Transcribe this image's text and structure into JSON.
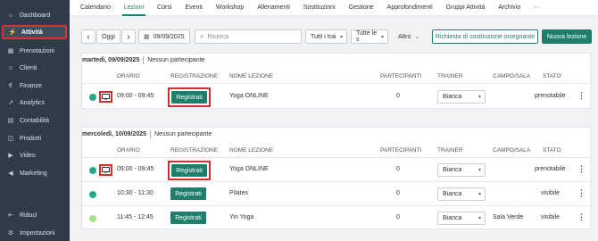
{
  "sidebar": {
    "items": [
      {
        "label": "Dashboard",
        "icon": "home-icon",
        "glyph": "⌂"
      },
      {
        "label": "Attività",
        "icon": "activity-icon",
        "glyph": "⚡",
        "active": true
      },
      {
        "label": "Prenotazioni",
        "icon": "calendar-icon",
        "glyph": "▦"
      },
      {
        "label": "Clienti",
        "icon": "user-icon",
        "glyph": "☺"
      },
      {
        "label": "Finanze",
        "icon": "euro-icon",
        "glyph": "€"
      },
      {
        "label": "Analytics",
        "icon": "chart-icon",
        "glyph": "↗"
      },
      {
        "label": "Contabilità",
        "icon": "ledger-icon",
        "glyph": "▤"
      },
      {
        "label": "Prodotti",
        "icon": "box-icon",
        "glyph": "◫"
      },
      {
        "label": "Video",
        "icon": "video-icon",
        "glyph": "▶"
      },
      {
        "label": "Marketing",
        "icon": "megaphone-icon",
        "glyph": "◀"
      },
      {
        "label": "Riduci",
        "icon": "collapse-icon",
        "glyph": "⇤"
      },
      {
        "label": "Impostazioni",
        "icon": "gear-icon",
        "glyph": "⚙"
      }
    ]
  },
  "tabs": [
    "Calendario",
    "Lezioni",
    "Corsi",
    "Eventi",
    "Workshop",
    "Allenamenti",
    "Sostituzioni",
    "Gestione",
    "Approfondimenti",
    "Gruppi Attività",
    "Archivio",
    "···"
  ],
  "active_tab": "Lezioni",
  "toolbar": {
    "prev": "‹",
    "today": "Oggi",
    "next": "›",
    "date_value": "09/09/2025",
    "search_placeholder": "Ricerca",
    "filter1": "Tutti i trai",
    "filter2": "Tutte le s",
    "other": "Altro",
    "request_button": "Richiesta di sostituzione insegnante",
    "new_button": "Nuova lezione"
  },
  "columns": {
    "orario": "ORARIO",
    "registrazione": "REGISTRAZIONE",
    "nome": "NOME LEZIONE",
    "partecipanti": "PARTECIPANTI",
    "trainer": "TRAINER",
    "campo": "CAMPO/SALA",
    "stato": "STATO"
  },
  "days": [
    {
      "date": "martedì, 09/09/2025",
      "participants_note": "Nessun partecipante",
      "lessons": [
        {
          "dot_color": "#26a68a",
          "online": true,
          "time": "09:00 - 09:45",
          "register": "Registrati",
          "name": "Yoga ONLINE",
          "participants": "0",
          "trainer": "Bianca",
          "room": "",
          "status": "prenotabile"
        }
      ]
    },
    {
      "date": "mercoledì, 10/09/2025",
      "participants_note": "Nessun partecipante",
      "lessons": [
        {
          "dot_color": "#26a68a",
          "online": true,
          "time": "09:00 - 09:45",
          "register": "Registrati",
          "name": "Yoga ONLINE",
          "participants": "0",
          "trainer": "Bianca",
          "room": "",
          "status": "prenotabile"
        },
        {
          "dot_color": "#26a68a",
          "online": false,
          "time": "10:30 - 11:30",
          "register": "Registrati",
          "name": "Pilates",
          "participants": "0",
          "trainer": "Bianca",
          "room": "",
          "status": "visibile"
        },
        {
          "dot_color": "#a3e58f",
          "online": false,
          "time": "11:45 - 12:45",
          "register": "Registrati",
          "name": "Yin Yoga",
          "participants": "0",
          "trainer": "Bianca",
          "room": "Sala Verde",
          "status": "visibile"
        }
      ]
    }
  ],
  "colors": {
    "accent": "#1e7d6b",
    "highlight": "#d32f2f",
    "sidebar": "#2f3a4a"
  }
}
